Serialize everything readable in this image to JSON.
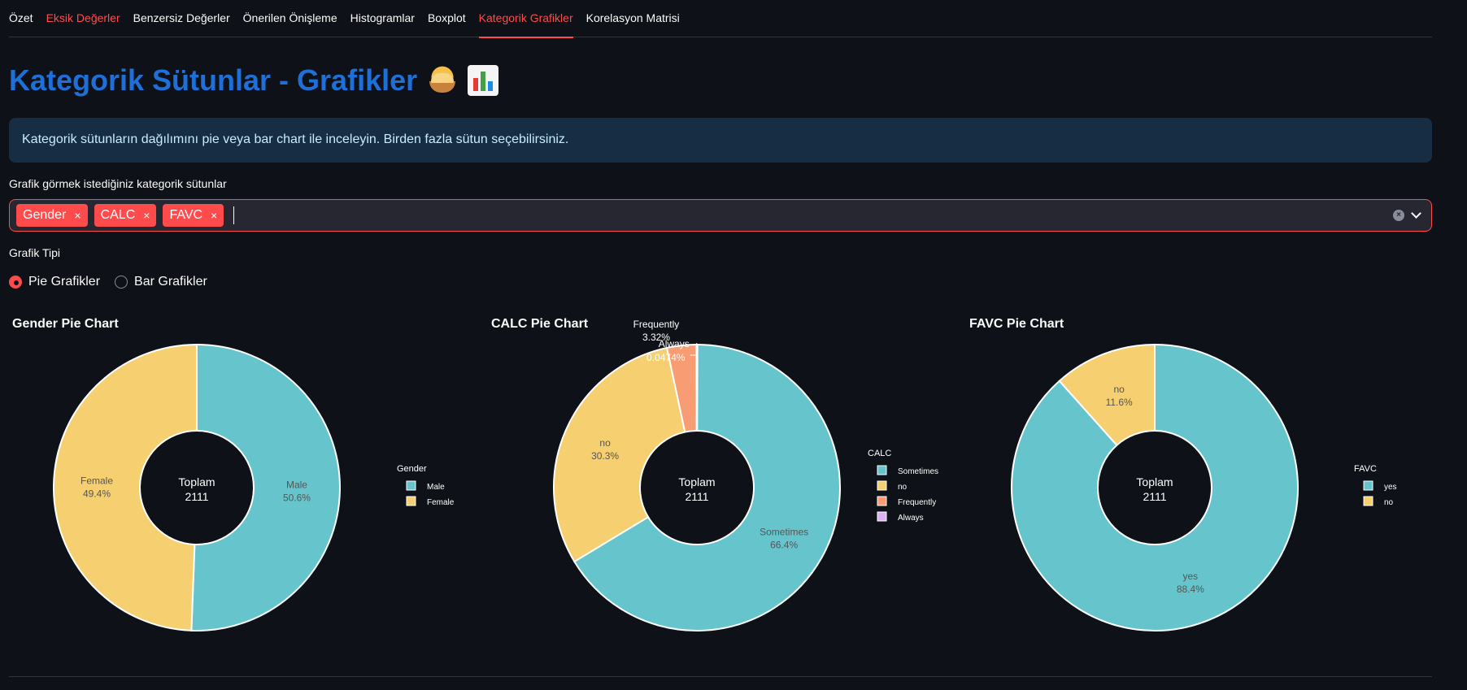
{
  "tabs": [
    {
      "label": "Özet",
      "style": "normal"
    },
    {
      "label": "Eksik Değerler",
      "style": "red"
    },
    {
      "label": "Benzersiz Değerler",
      "style": "normal"
    },
    {
      "label": "Önerilen Önişleme",
      "style": "normal"
    },
    {
      "label": "Histogramlar",
      "style": "normal"
    },
    {
      "label": "Boxplot",
      "style": "normal"
    },
    {
      "label": "Kategorik Grafikler",
      "style": "active"
    },
    {
      "label": "Korelasyon Matrisi",
      "style": "normal"
    }
  ],
  "page": {
    "title": "Kategorik Sütunlar - Grafikler",
    "title_icons": [
      "pie-icon",
      "bar-chart-icon"
    ],
    "info": "Kategorik sütunların dağılımını pie veya bar chart ile inceleyin. Birden fazla sütun seçebilirsiniz.",
    "select_label": "Grafik görmek istediğiniz kategorik sütunlar",
    "selected": [
      "Gender",
      "CALC",
      "FAVC"
    ],
    "chip_remove_glyph": "×",
    "chart_type_label": "Grafik Tipi",
    "chart_type_options": [
      {
        "label": "Pie Grafikler",
        "selected": true
      },
      {
        "label": "Bar Grafikler",
        "selected": false
      }
    ]
  },
  "colors": {
    "accent": "#ff4b4b",
    "title": "#1f6fd8",
    "teal": "#66c5cc",
    "yellow": "#f6cf71",
    "salmon": "#f89c74",
    "lilac": "#dcb0f2"
  },
  "chart_data": [
    {
      "type": "pie",
      "title": "Gender Pie Chart",
      "legend_title": "Gender",
      "center_label": "Toplam",
      "center_value": "2111",
      "slices": [
        {
          "label": "Male",
          "percent": 50.6,
          "pct_text": "50.6%",
          "color": "#66c5cc"
        },
        {
          "label": "Female",
          "percent": 49.4,
          "pct_text": "49.4%",
          "color": "#f6cf71"
        }
      ]
    },
    {
      "type": "pie",
      "title": "CALC Pie Chart",
      "legend_title": "CALC",
      "center_label": "Toplam",
      "center_value": "2111",
      "slices": [
        {
          "label": "Sometimes",
          "percent": 66.4,
          "pct_text": "66.4%",
          "color": "#66c5cc"
        },
        {
          "label": "no",
          "percent": 30.3,
          "pct_text": "30.3%",
          "color": "#f6cf71"
        },
        {
          "label": "Frequently",
          "percent": 3.32,
          "pct_text": "3.32%",
          "color": "#f89c74"
        },
        {
          "label": "Always",
          "percent": 0.0474,
          "pct_text": "0.0474%",
          "color": "#dcb0f2"
        }
      ]
    },
    {
      "type": "pie",
      "title": "FAVC Pie Chart",
      "legend_title": "FAVC",
      "center_label": "Toplam",
      "center_value": "2111",
      "slices": [
        {
          "label": "yes",
          "percent": 88.4,
          "pct_text": "88.4%",
          "color": "#66c5cc"
        },
        {
          "label": "no",
          "percent": 11.6,
          "pct_text": "11.6%",
          "color": "#f6cf71"
        }
      ]
    }
  ]
}
